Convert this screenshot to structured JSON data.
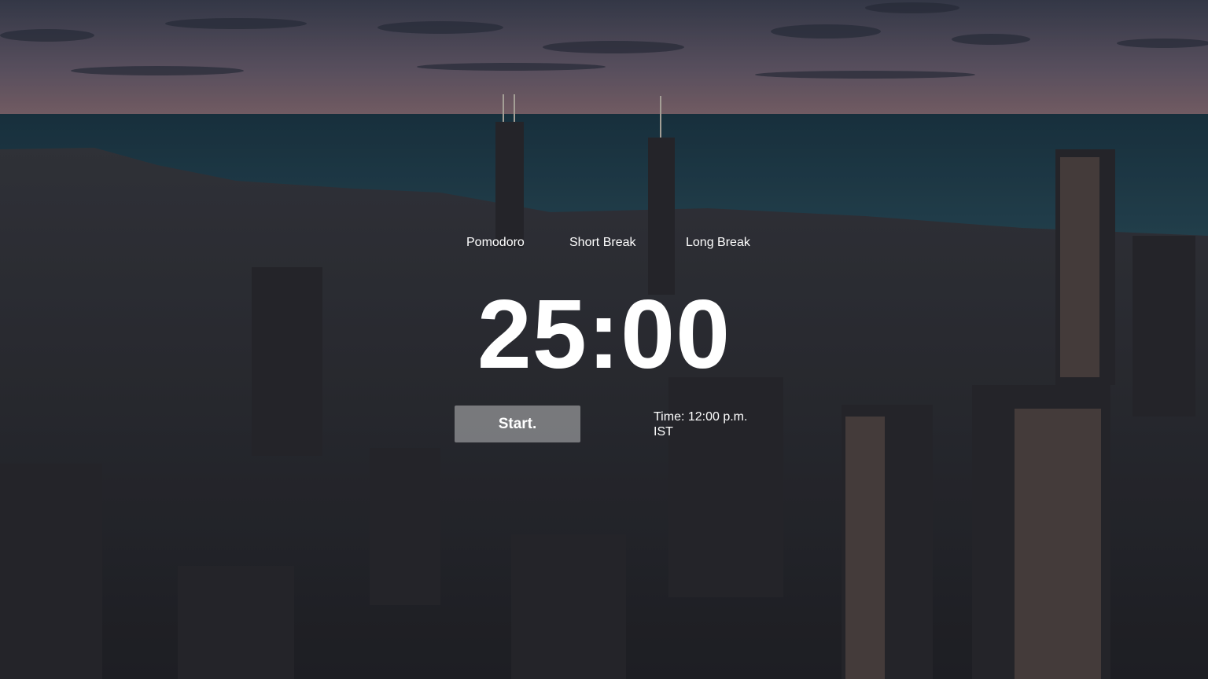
{
  "background": {
    "description_icon": "city-skyline-photo",
    "sky_color": "#4e4f63",
    "sea_color": "#20404f",
    "city_color": "#2a2c33"
  },
  "tabs": [
    {
      "label": "Pomodoro"
    },
    {
      "label": "Short Break"
    },
    {
      "label": "Long Break"
    }
  ],
  "timer": {
    "display": "25:00"
  },
  "controls": {
    "start_label": "Start."
  },
  "clock": {
    "line1": "Time: 12:00 p.m.",
    "line2": "IST"
  }
}
